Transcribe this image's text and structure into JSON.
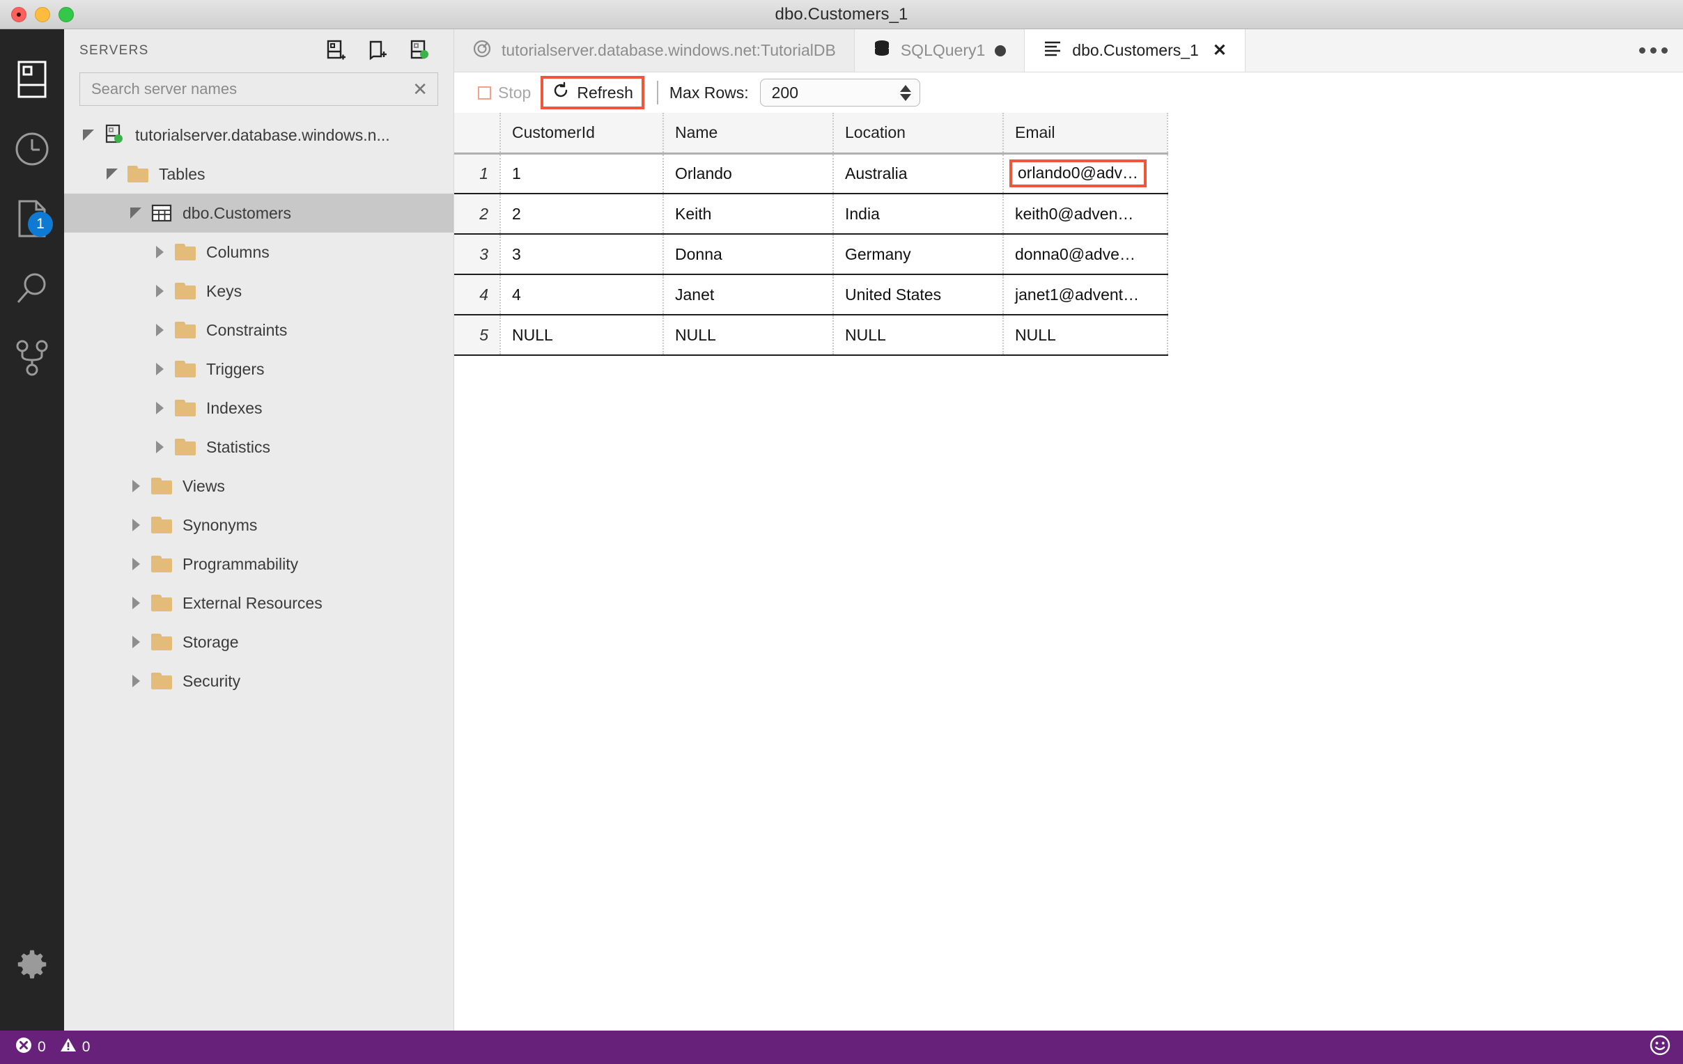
{
  "window": {
    "title": "dbo.Customers_1",
    "traffic_lights": [
      "close",
      "minimize",
      "zoom"
    ]
  },
  "activitybar": {
    "items": [
      {
        "name": "servers-icon",
        "label": "Servers"
      },
      {
        "name": "history-icon",
        "label": "History"
      },
      {
        "name": "tasks-icon",
        "label": "Tasks",
        "badge": "1"
      },
      {
        "name": "search-icon",
        "label": "Search"
      },
      {
        "name": "source-control-icon",
        "label": "Source Control"
      }
    ],
    "bottom": {
      "name": "gear-icon",
      "label": "Manage"
    }
  },
  "sidebar": {
    "title": "SERVERS",
    "header_icons": [
      {
        "name": "new-connection-icon",
        "label": "New Connection"
      },
      {
        "name": "new-server-group-icon",
        "label": "New Server Group"
      },
      {
        "name": "connected-server-icon",
        "label": "Connected Servers"
      }
    ],
    "search": {
      "placeholder": "Search server names",
      "value": "",
      "clear_label": "✕"
    },
    "tree": [
      {
        "label": "tutorialserver.database.windows.n...",
        "indent": 0,
        "twisty": "down",
        "icon": "server-icon",
        "selected": false
      },
      {
        "label": "Tables",
        "indent": 1,
        "twisty": "down",
        "icon": "folder-icon",
        "selected": false
      },
      {
        "label": "dbo.Customers",
        "indent": 2,
        "twisty": "down",
        "icon": "table-icon",
        "selected": true
      },
      {
        "label": "Columns",
        "indent": 3,
        "twisty": "right",
        "icon": "folder-icon",
        "selected": false
      },
      {
        "label": "Keys",
        "indent": 3,
        "twisty": "right",
        "icon": "folder-icon",
        "selected": false
      },
      {
        "label": "Constraints",
        "indent": 3,
        "twisty": "right",
        "icon": "folder-icon",
        "selected": false
      },
      {
        "label": "Triggers",
        "indent": 3,
        "twisty": "right",
        "icon": "folder-icon",
        "selected": false
      },
      {
        "label": "Indexes",
        "indent": 3,
        "twisty": "right",
        "icon": "folder-icon",
        "selected": false
      },
      {
        "label": "Statistics",
        "indent": 3,
        "twisty": "right",
        "icon": "folder-icon",
        "selected": false
      },
      {
        "label": "Views",
        "indent": 2,
        "twisty": "right",
        "icon": "folder-icon",
        "selected": false
      },
      {
        "label": "Synonyms",
        "indent": 2,
        "twisty": "right",
        "icon": "folder-icon",
        "selected": false
      },
      {
        "label": "Programmability",
        "indent": 2,
        "twisty": "right",
        "icon": "folder-icon",
        "selected": false
      },
      {
        "label": "External Resources",
        "indent": 2,
        "twisty": "right",
        "icon": "folder-icon",
        "selected": false
      },
      {
        "label": "Storage",
        "indent": 2,
        "twisty": "right",
        "icon": "folder-icon",
        "selected": false
      },
      {
        "label": "Security",
        "indent": 2,
        "twisty": "right",
        "icon": "folder-icon",
        "selected": false
      }
    ]
  },
  "tabs": [
    {
      "label": "tutorialserver.database.windows.net:TutorialDB",
      "icon": "dashboard-icon",
      "state": "inactive",
      "dirty": false,
      "closable": false
    },
    {
      "label": "SQLQuery1",
      "icon": "database-icon",
      "state": "semi",
      "dirty": true,
      "closable": false
    },
    {
      "label": "dbo.Customers_1",
      "icon": "table-editor-icon",
      "state": "active",
      "dirty": false,
      "closable": true
    }
  ],
  "tabbar_overflow": {
    "name": "more-actions-icon",
    "label": "•••"
  },
  "results_toolbar": {
    "stop_label": "Stop",
    "refresh_label": "Refresh",
    "max_rows_label": "Max Rows:",
    "max_rows_value": "200",
    "highlight_color": "#f1553a"
  },
  "grid": {
    "columns": [
      "CustomerId",
      "Name",
      "Location",
      "Email"
    ],
    "rows": [
      {
        "n": "1",
        "cells": [
          "1",
          "Orlando",
          "Australia",
          "orlando0@adv…"
        ],
        "highlight_col": 3
      },
      {
        "n": "2",
        "cells": [
          "2",
          "Keith",
          "India",
          "keith0@adven…"
        ],
        "highlight_col": -1
      },
      {
        "n": "3",
        "cells": [
          "3",
          "Donna",
          "Germany",
          "donna0@adve…"
        ],
        "highlight_col": -1
      },
      {
        "n": "4",
        "cells": [
          "4",
          "Janet",
          "United States",
          "janet1@advent…"
        ],
        "highlight_col": -1
      },
      {
        "n": "5",
        "cells": [
          "NULL",
          "NULL",
          "NULL",
          "NULL"
        ],
        "highlight_col": -1
      }
    ]
  },
  "statusbar": {
    "errors_icon": "error-icon",
    "errors_count": "0",
    "warnings_icon": "warning-icon",
    "warnings_count": "0",
    "feedback_icon": "smiley-icon",
    "background": "#68217a"
  }
}
